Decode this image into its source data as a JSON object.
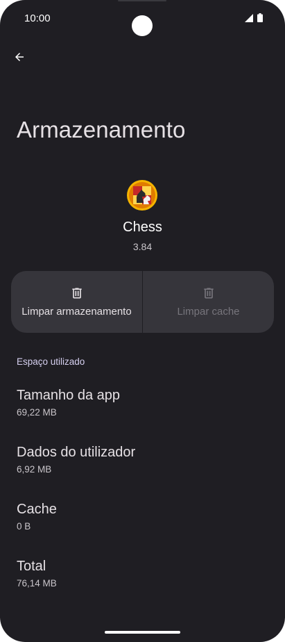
{
  "status_bar": {
    "time": "10:00"
  },
  "header": {
    "title": "Armazenamento"
  },
  "app": {
    "name": "Chess",
    "version": "3.84"
  },
  "actions": {
    "clear_storage": "Limpar armazenamento",
    "clear_cache": "Limpar cache"
  },
  "usage": {
    "section_title": "Espaço utilizado",
    "rows": [
      {
        "title": "Tamanho da app",
        "value": "69,22 MB"
      },
      {
        "title": "Dados do utilizador",
        "value": "6,92 MB"
      },
      {
        "title": "Cache",
        "value": "0 B"
      },
      {
        "title": "Total",
        "value": "76,14 MB"
      }
    ]
  },
  "icons": {
    "back": "arrow-back-icon",
    "delete": "trash-icon",
    "signal": "signal-icon",
    "battery": "battery-icon"
  },
  "colors": {
    "background": "#1f1e23",
    "card": "#36353b",
    "section_accent": "#d6d0f0",
    "disabled_text": "#77757c"
  }
}
